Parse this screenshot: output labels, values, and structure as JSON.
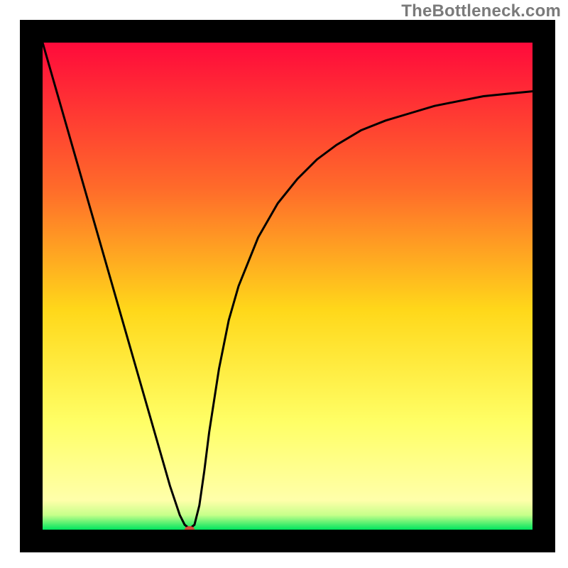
{
  "attribution": "TheBottleneck.com",
  "chart_data": {
    "type": "line",
    "title": "",
    "xlabel": "",
    "ylabel": "",
    "xlim": [
      0,
      100
    ],
    "ylim": [
      0,
      100
    ],
    "grid": false,
    "legend": false,
    "background": {
      "type": "vertical-gradient",
      "stops": [
        {
          "y": 0,
          "color": "#ff0a3b"
        },
        {
          "y": 30,
          "color": "#ff6b2a"
        },
        {
          "y": 55,
          "color": "#ffd81a"
        },
        {
          "y": 78,
          "color": "#ffff66"
        },
        {
          "y": 94,
          "color": "#ffffaa"
        },
        {
          "y": 97,
          "color": "#c6ff8a"
        },
        {
          "y": 100,
          "color": "#00e55e"
        }
      ]
    },
    "series": [
      {
        "name": "bottleneck-curve",
        "color": "#000000",
        "x": [
          0,
          2,
          4,
          6,
          8,
          10,
          12,
          14,
          16,
          18,
          20,
          22,
          24,
          26,
          28,
          29,
          30,
          31,
          32,
          33,
          34,
          36,
          38,
          40,
          44,
          48,
          52,
          56,
          60,
          65,
          70,
          75,
          80,
          85,
          90,
          95,
          100
        ],
        "values": [
          100,
          93,
          86,
          79,
          72,
          65,
          58,
          51,
          44,
          37,
          30,
          23,
          16,
          9,
          3,
          1,
          0.2,
          1,
          5,
          12,
          20,
          33,
          43,
          50,
          60,
          67,
          72,
          76,
          79,
          82,
          84,
          85.5,
          87,
          88,
          89,
          89.5,
          90
        ]
      }
    ],
    "marker": {
      "name": "optimal-point",
      "x": 30,
      "y": 0,
      "color": "#d44a3a",
      "rx": 7,
      "ry": 5
    }
  },
  "frame": {
    "padT": 28,
    "padR": 18,
    "padB": 22,
    "padL": 28,
    "stroke": "#000000",
    "strokeWidth": 32
  }
}
